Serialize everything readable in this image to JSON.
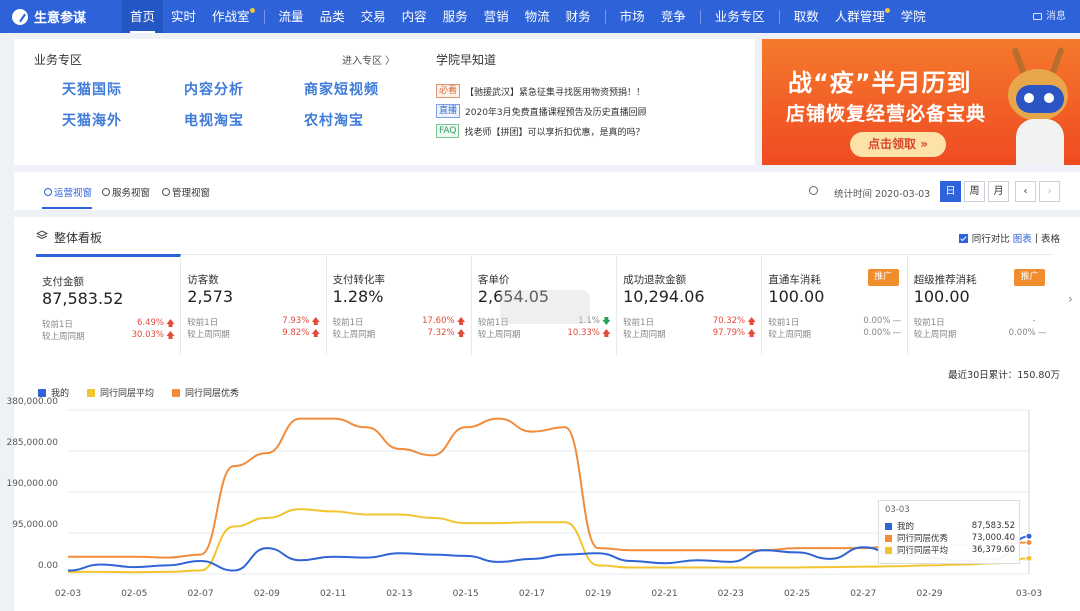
{
  "app": {
    "name": "生意参谋"
  },
  "nav": {
    "items": [
      {
        "label": "首页",
        "active": true,
        "dot": false
      },
      {
        "label": "实时",
        "active": false,
        "dot": false
      },
      {
        "label": "作战室",
        "active": false,
        "dot": true
      },
      {
        "label": "流量",
        "active": false,
        "dot": false
      },
      {
        "label": "品类",
        "active": false,
        "dot": false
      },
      {
        "label": "交易",
        "active": false,
        "dot": false
      },
      {
        "label": "内容",
        "active": false,
        "dot": false
      },
      {
        "label": "服务",
        "active": false,
        "dot": false
      },
      {
        "label": "营销",
        "active": false,
        "dot": false
      },
      {
        "label": "物流",
        "active": false,
        "dot": false
      },
      {
        "label": "财务",
        "active": false,
        "dot": false
      },
      {
        "label": "市场",
        "active": false,
        "dot": false
      },
      {
        "label": "竞争",
        "active": false,
        "dot": false
      },
      {
        "label": "业务专区",
        "active": false,
        "dot": false
      },
      {
        "label": "取数",
        "active": false,
        "dot": false
      },
      {
        "label": "人群管理",
        "active": false,
        "dot": true
      },
      {
        "label": "学院",
        "active": false,
        "dot": false
      }
    ],
    "message_label": "消息"
  },
  "business": {
    "title": "业务专区",
    "more": "进入专区 〉",
    "links": [
      "天猫国际",
      "内容分析",
      "商家短视频",
      "天猫海外",
      "电视淘宝",
      "农村淘宝"
    ]
  },
  "school": {
    "title": "学院早知道",
    "items": [
      {
        "tag": "必看",
        "tag_style": "red",
        "text": "【驰援武汉】紧急征集寻找医用物资预捐！！"
      },
      {
        "tag": "直播",
        "tag_style": "blue",
        "text": "2020年3月免费直播课程预告及历史直播回顾"
      },
      {
        "tag": "FAQ",
        "tag_style": "green",
        "text": "找老师【拼团】可以享折扣优惠，是真的吗？"
      }
    ]
  },
  "banner": {
    "line1": "战“疫”半月历到",
    "line2": "店铺恢复经营必备宝典",
    "button": "点击领取 »"
  },
  "view_tabs": [
    {
      "label": "运营视窗",
      "active": true
    },
    {
      "label": "服务视窗",
      "active": false
    },
    {
      "label": "管理视窗",
      "active": false
    }
  ],
  "stat_time": "统计时间 2020-03-03",
  "period_buttons": [
    {
      "label": "日",
      "active": true
    },
    {
      "label": "周",
      "active": false
    },
    {
      "label": "月",
      "active": false
    },
    {
      "label": "‹",
      "active": false
    },
    {
      "label": "›",
      "active": false
    }
  ],
  "board": {
    "title": "整体看板",
    "peer_compare": "同行对比",
    "chart_link": "图表",
    "divider": "|",
    "table_link": "表格",
    "total_30": "最近30日累计：150.80万"
  },
  "kpis": [
    {
      "name": "支付金额",
      "value": "87,583.52",
      "badge": "",
      "rows": [
        {
          "label": "较前1日",
          "pct": "6.49%",
          "dir": "up"
        },
        {
          "label": "较上周同期",
          "pct": "30.03%",
          "dir": "up"
        }
      ]
    },
    {
      "name": "访客数",
      "value": "2,573",
      "badge": "",
      "rows": [
        {
          "label": "较前1日",
          "pct": "7.93%",
          "dir": "up"
        },
        {
          "label": "较上周同期",
          "pct": "9.82%",
          "dir": "up"
        }
      ]
    },
    {
      "name": "支付转化率",
      "value": "1.28%",
      "badge": "",
      "rows": [
        {
          "label": "较前1日",
          "pct": "17.60%",
          "dir": "up"
        },
        {
          "label": "较上周同期",
          "pct": "7.32%",
          "dir": "up"
        }
      ]
    },
    {
      "name": "客单价",
      "value": "2,654.05",
      "badge": "",
      "rows": [
        {
          "label": "较前1日",
          "pct": "1.1%",
          "dir": "down"
        },
        {
          "label": "较上周同期",
          "pct": "10.33%",
          "dir": "up"
        }
      ]
    },
    {
      "name": "成功退款金额",
      "value": "10,294.06",
      "badge": "",
      "rows": [
        {
          "label": "较前1日",
          "pct": "70.32%",
          "dir": "up"
        },
        {
          "label": "较上周同期",
          "pct": "97.79%",
          "dir": "up"
        }
      ]
    },
    {
      "name": "直通车消耗",
      "value": "100.00",
      "badge": "推广",
      "rows": [
        {
          "label": "较前1日",
          "pct": "0.00%",
          "dir": "flat"
        },
        {
          "label": "较上周同期",
          "pct": "0.00%",
          "dir": "flat"
        }
      ]
    },
    {
      "name": "超级推荐消耗",
      "value": "100.00",
      "badge": "推广",
      "rows": [
        {
          "label": "较前1日",
          "pct": "-",
          "dir": "none"
        },
        {
          "label": "较上周同期",
          "pct": "0.00%",
          "dir": "flat"
        }
      ]
    }
  ],
  "tooltip": {
    "date": "03-03",
    "rows": [
      {
        "name": "我的",
        "value": "87,583.52"
      },
      {
        "name": "同行同层优秀",
        "value": "73,000.40"
      },
      {
        "name": "同行同层平均",
        "value": "36,379.60"
      }
    ]
  },
  "chart_data": {
    "type": "line",
    "x": [
      "02-03",
      "02-04",
      "02-05",
      "02-06",
      "02-07",
      "02-08",
      "02-09",
      "02-10",
      "02-11",
      "02-12",
      "02-13",
      "02-14",
      "02-15",
      "02-16",
      "02-17",
      "02-18",
      "02-19",
      "02-20",
      "02-21",
      "02-22",
      "02-23",
      "02-24",
      "02-25",
      "02-26",
      "02-27",
      "02-28",
      "02-29",
      "03-01",
      "03-02",
      "03-03"
    ],
    "x_tick_labels": [
      "02-03",
      "02-05",
      "02-07",
      "02-09",
      "02-11",
      "02-13",
      "02-15",
      "02-17",
      "02-19",
      "02-21",
      "02-23",
      "02-25",
      "02-27",
      "02-29",
      "03-03"
    ],
    "y_tick_labels": [
      "380,000.00",
      "285,000.00",
      "190,000.00",
      "95,000.00",
      "0.00"
    ],
    "ylim": [
      0,
      380000
    ],
    "grid": true,
    "legend_position": "top-left",
    "series": [
      {
        "name": "我的",
        "color": "#2e64d4",
        "values": [
          8000,
          22000,
          16000,
          20000,
          30000,
          8000,
          60000,
          32000,
          40000,
          38000,
          48000,
          45000,
          42000,
          28000,
          35000,
          45000,
          48000,
          30000,
          25000,
          32000,
          28000,
          55000,
          50000,
          35000,
          62000,
          45000,
          38000,
          30000,
          35000,
          87583
        ]
      },
      {
        "name": "同行同层平均",
        "color": "#f2c430",
        "values": [
          5000,
          5000,
          4000,
          5000,
          8000,
          110000,
          130000,
          150000,
          145000,
          138000,
          138000,
          130000,
          118000,
          118000,
          120000,
          120000,
          20000,
          15000,
          15000,
          15000,
          15000,
          15000,
          15000,
          16000,
          17000,
          18000,
          20000,
          22000,
          25000,
          36380
        ]
      },
      {
        "name": "同行同层优秀",
        "color": "#f08c3c",
        "values": [
          40000,
          40000,
          40000,
          38000,
          45000,
          250000,
          280000,
          360000,
          360000,
          340000,
          290000,
          275000,
          340000,
          360000,
          330000,
          340000,
          60000,
          55000,
          55000,
          55000,
          55000,
          55000,
          60000,
          60000,
          60000,
          65000,
          65000,
          68000,
          70000,
          73000
        ]
      }
    ]
  }
}
